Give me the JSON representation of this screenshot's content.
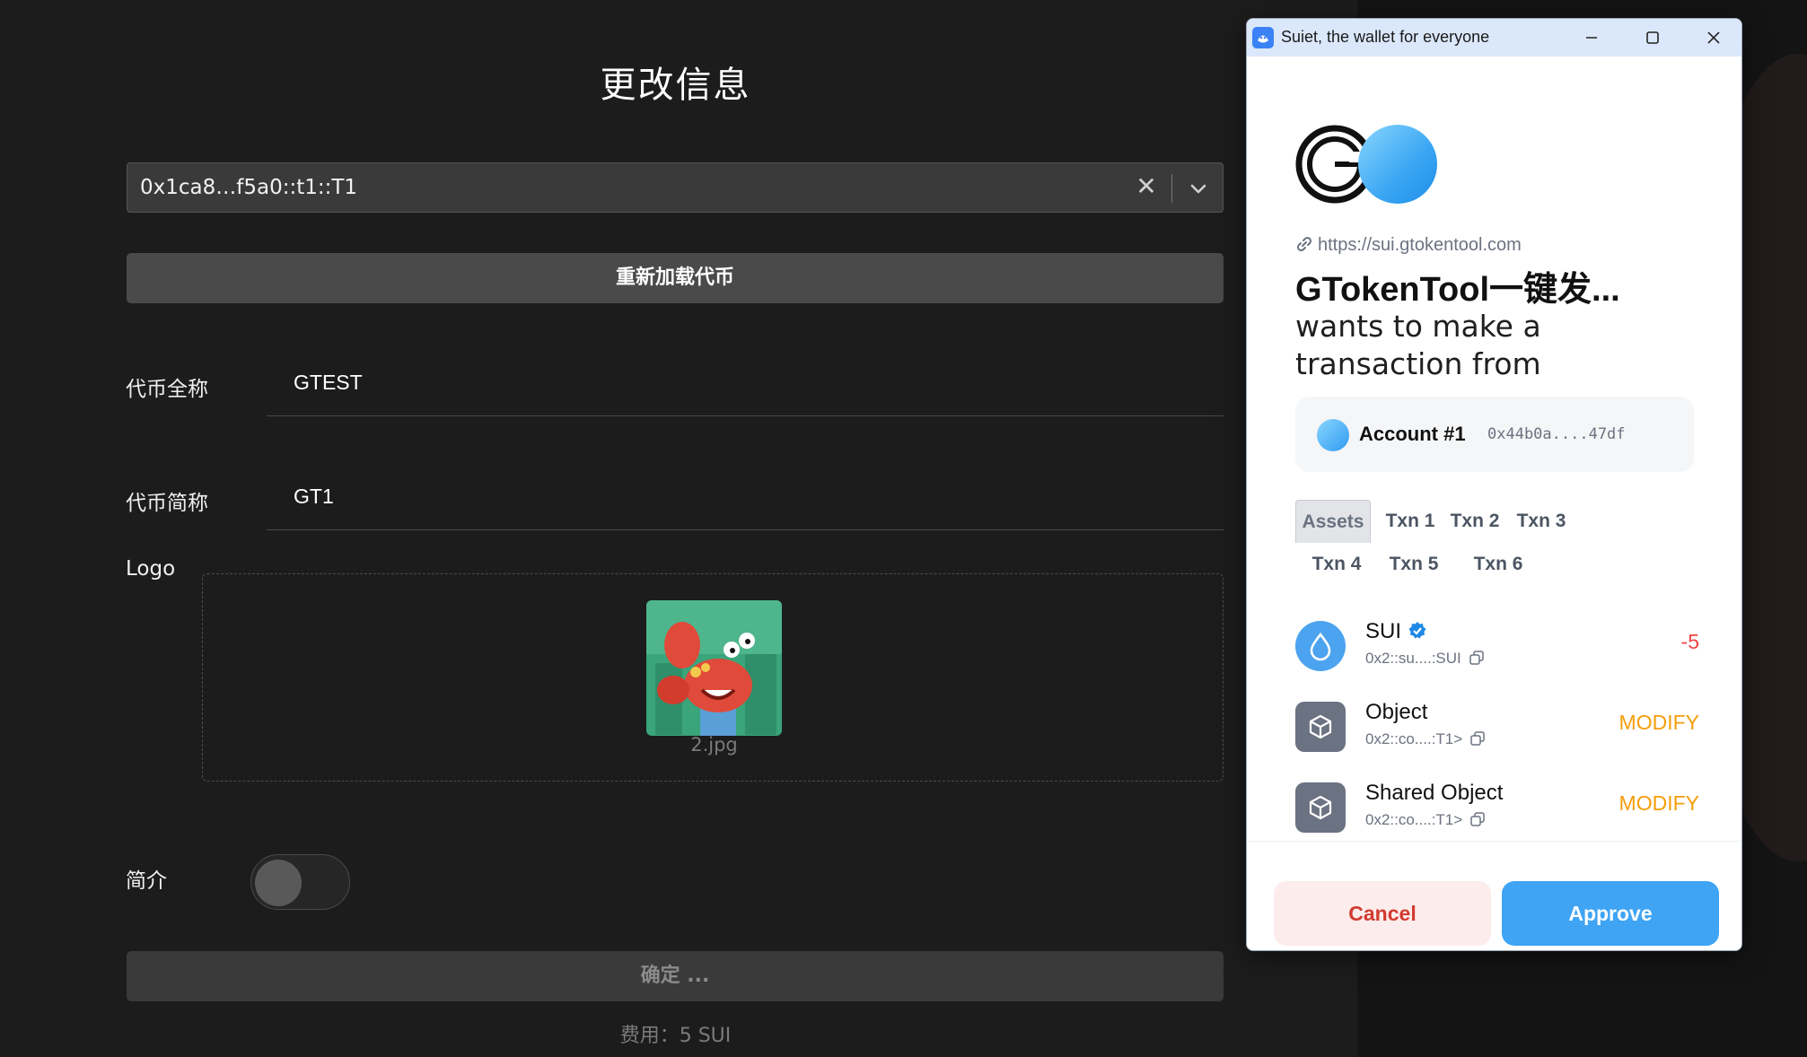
{
  "app": {
    "title": "更改信息",
    "token_select": {
      "value": "0x1ca8…f5a0::t1::T1",
      "clear_icon": "close-icon",
      "dropdown_icon": "chevron-down-icon"
    },
    "reload_button": "重新加载代币",
    "fields": [
      {
        "label": "代币全称",
        "value": "GTEST"
      },
      {
        "label": "代币简称",
        "value": "GT1"
      }
    ],
    "logo": {
      "label": "Logo",
      "file_name": "2.jpg"
    },
    "intro": {
      "label": "简介",
      "enabled": false
    },
    "confirm_button": "确定 ...",
    "fee": "费用：5 SUI"
  },
  "wallet": {
    "window_title": "Suiet, the wallet for everyone",
    "window_buttons": [
      "minimize-icon",
      "maximize-icon",
      "close-icon"
    ],
    "origin_url": "https://sui.gtokentool.com",
    "origin_name": "GTokenTool一键发...",
    "description": "wants to make a transaction from",
    "account": {
      "name": "Account #1",
      "address": "0x44b0a....47df"
    },
    "tabs": [
      "Assets",
      "Txn 1",
      "Txn 2",
      "Txn 3",
      "Txn 4",
      "Txn 5",
      "Txn 6"
    ],
    "active_tab": "Assets",
    "assets": [
      {
        "name": "SUI",
        "type": "0x2::su....:SUI",
        "amount": "-5",
        "verified": true,
        "icon": "sui-drop-icon"
      },
      {
        "name": "Object",
        "type": "0x2::co....:T1>",
        "amount": "MODIFY",
        "icon": "cube-icon"
      },
      {
        "name": "Shared Object",
        "type": "0x2::co....:T1>",
        "amount": "MODIFY",
        "icon": "cube-icon"
      }
    ],
    "cancel_button": "Cancel",
    "approve_button": "Approve",
    "colors": {
      "accent": "#3fa4f4",
      "negative": "#ef4444",
      "modify": "#f59e0b",
      "cancel_text": "#d23a2f"
    }
  }
}
